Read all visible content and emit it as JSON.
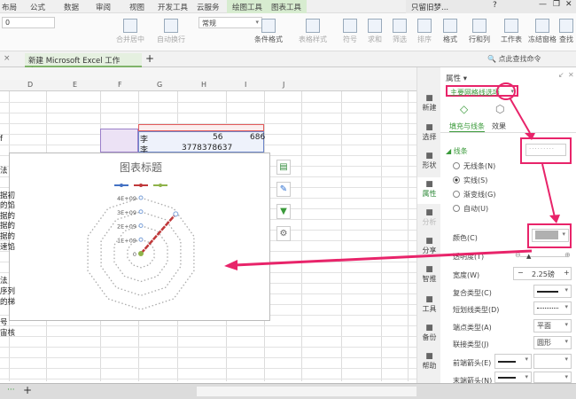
{
  "menu_tabs": [
    "布局",
    "公式",
    "数据",
    "审阅",
    "视图",
    "开发工具",
    "云服务",
    "绘图工具",
    "图表工具"
  ],
  "title_area": {
    "user": "只留旧梦...",
    "help": "?"
  },
  "ribbon": {
    "font_size": "0",
    "number_format": "常规",
    "buttons": [
      "合并居中",
      "自动换行",
      "条件格式",
      "表格样式",
      "符号",
      "求和",
      "筛选",
      "排序",
      "格式",
      "行和列",
      "工作表",
      "冻结窗格",
      "查找"
    ]
  },
  "file_tab": {
    "name": "新建 Microsoft Excel 工作表.xlsx *",
    "add": "+"
  },
  "search_cmd": "点此查找命令",
  "columns": [
    "D",
    "E",
    "F",
    "G",
    "H",
    "I",
    "J"
  ],
  "cells": {
    "g1": "李",
    "h1": "56",
    "i1": "686",
    "g2": "李",
    "h2": "3778378637"
  },
  "left_fragments": [
    "f",
    "法",
    "据初",
    "的馅",
    "据的",
    "据的",
    "据的",
    "速馅",
    "法",
    "序列",
    "的梯",
    "号",
    "宙核"
  ],
  "chart": {
    "title": "图表标题",
    "series_colors": [
      "#4472c4",
      "#c0393b",
      "#8fb34a"
    ],
    "chart_data": {
      "type": "radar",
      "title": "图表标题",
      "tick_labels": [
        "0",
        "1E+09",
        "2E+09",
        "3E+09",
        "4E+09"
      ],
      "rlim": [
        0,
        4000000000
      ],
      "series": [
        {
          "values": [
            3778378637
          ]
        }
      ],
      "gridlines": "dotted"
    }
  },
  "sidebar": [
    {
      "label": "新建",
      "icon": "new-icon"
    },
    {
      "label": "选择",
      "icon": "select-icon"
    },
    {
      "label": "形状",
      "icon": "shape-icon"
    },
    {
      "label": "属性",
      "icon": "property-icon"
    },
    {
      "label": "分析",
      "icon": "analysis-icon"
    },
    {
      "label": "分享",
      "icon": "share-icon"
    },
    {
      "label": "智推",
      "icon": "bulb-icon"
    },
    {
      "label": "工具",
      "icon": "toolbox-icon"
    },
    {
      "label": "备份",
      "icon": "backup-icon"
    },
    {
      "label": "帮助",
      "icon": "help-icon"
    }
  ],
  "panel": {
    "title": "属性 ▾",
    "selector": "主要网格线选项",
    "tabs": [
      "填充与线条",
      "效果"
    ],
    "section": "线条",
    "radios": [
      {
        "label": "无线条(N)",
        "checked": false
      },
      {
        "label": "实线(S)",
        "checked": true
      },
      {
        "label": "渐变线(G)",
        "checked": false
      },
      {
        "label": "自动(U)",
        "checked": false
      }
    ],
    "color_label": "颜色(C)",
    "color_value": "#b0b0b0",
    "transparency_label": "透明度(T)",
    "transparency": 0,
    "width_label": "宽度(W)",
    "width_value": "2.25磅",
    "compound_label": "复合类型(C)",
    "dash_label": "短划线类型(D)",
    "cap_label": "端点类型(A)",
    "cap_value": "平面",
    "join_label": "联接类型(J)",
    "join_value": "圆形",
    "begin_arrow_label": "前端箭头(E)",
    "end_arrow_label": "末端箭头(N)"
  },
  "annotation_color": "#e8246a"
}
